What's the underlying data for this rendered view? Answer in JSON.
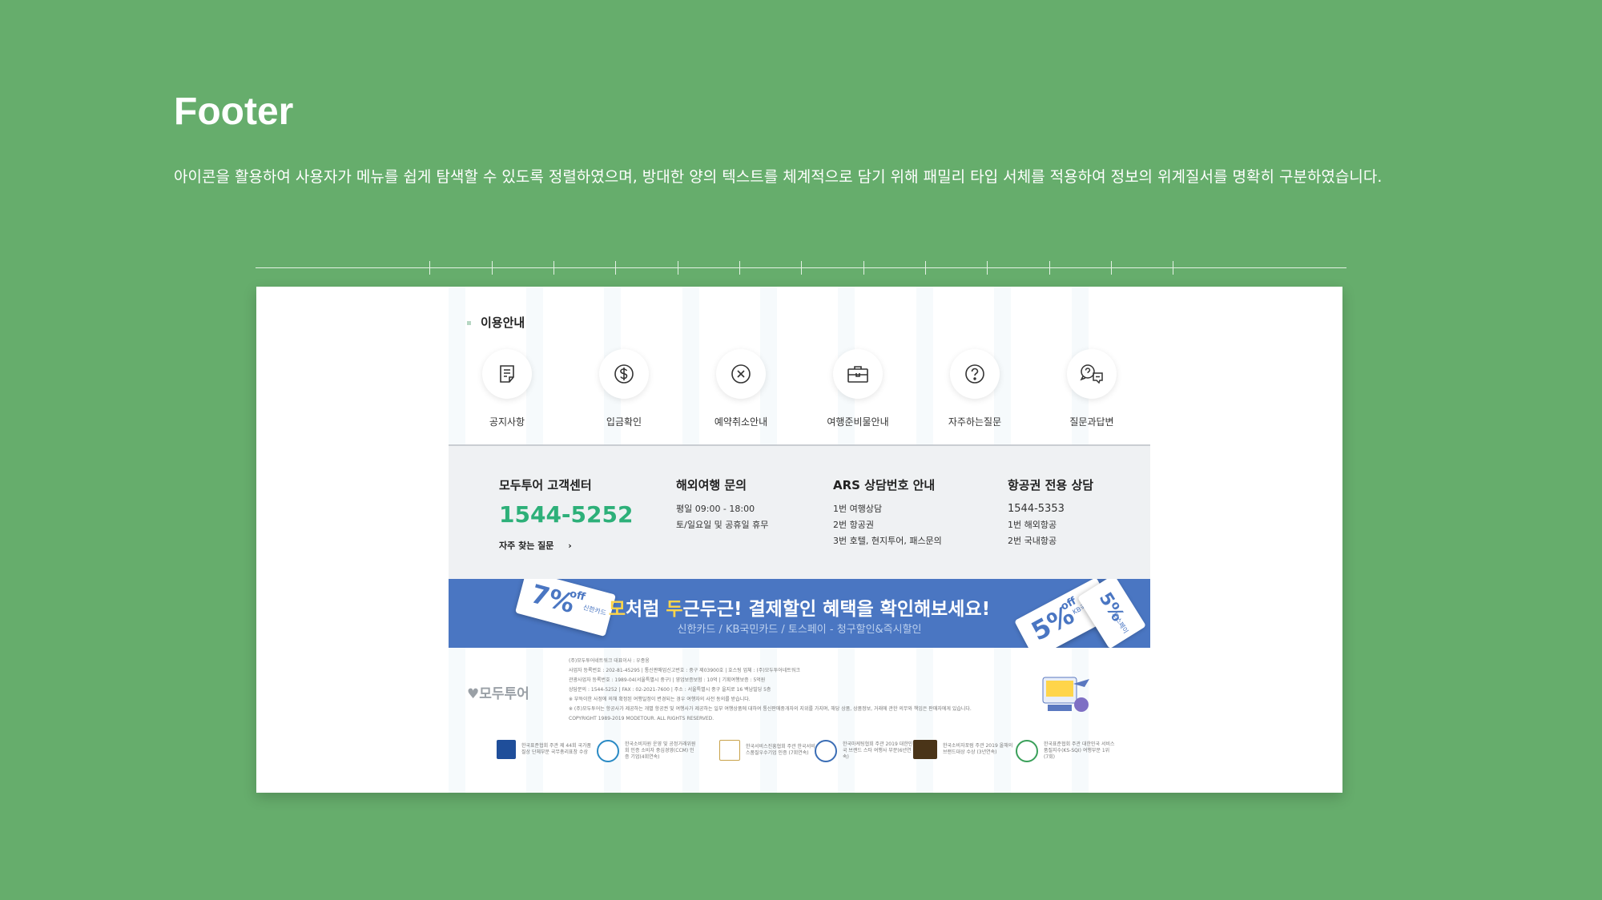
{
  "header": {
    "title": "Footer",
    "description": "아이콘을 활용하여 사용자가 메뉴를 쉽게 탐색할 수 있도록 정렬하였으며, 방대한 양의 텍스트를 체계적으로 담기 위해 패밀리 타입 서체를 적용하여 정보의 위계질서를 명확히 구분하였습니다."
  },
  "guide": {
    "section_title": "이용안내",
    "items": [
      {
        "label": "공지사항",
        "icon": "notice-icon"
      },
      {
        "label": "입금확인",
        "icon": "dollar-icon"
      },
      {
        "label": "예약취소안내",
        "icon": "cancel-icon"
      },
      {
        "label": "여행준비물안내",
        "icon": "briefcase-icon"
      },
      {
        "label": "자주하는질문",
        "icon": "question-icon"
      },
      {
        "label": "질문과답변",
        "icon": "chat-icon"
      }
    ]
  },
  "contact": {
    "center_title": "모두투어 고객센터",
    "center_phone": "1544-5252",
    "faq_link": "자주 찾는 질문",
    "overseas_title": "해외여행 문의",
    "overseas_lines": [
      "평일 09:00 - 18:00",
      "토/일요일 및 공휴일 휴무"
    ],
    "ars_title": "ARS 상담번호 안내",
    "ars_lines": [
      "1번 여행상담",
      "2번 항공권",
      "3번 호텔, 현지투어, 패스문의"
    ],
    "air_title": "항공권 전용 상담",
    "air_lines": [
      "1544-5353",
      "1번 해외항공",
      "2번 국내항공"
    ]
  },
  "banner": {
    "hl1": "모",
    "text1": "처럼 ",
    "hl2": "두",
    "text2": "근두근! 결제할인 혜택을 확인해보세요!",
    "sub": "신한카드 / KB국민카드 / 토스페이 - 청구할인&즉시할인",
    "ticket_left_value": "7%",
    "ticket_left_off": "off",
    "ticket_left_brand": "신한카드",
    "ticket_right_value": "5%",
    "ticket_right_off": "off",
    "ticket_right_brand": "KB국민카드",
    "ticket_far_value": "5%",
    "ticket_far_brand": "토스페이"
  },
  "footer": {
    "logo": "모두투어",
    "company_lines": [
      "(주)모두투어네트워크 대표이사 : 우종웅",
      "사업자 등록번호 : 202-81-45295 | 통신판매업신고번호 : 중구 제03900호 | 호스팅 업체 : (주)모두투어네트워크",
      "관광사업자 등록번호 : 1989-04(서울특별시 중구) | 영업보증보험 : 10억 | 기획여행보증 : 5억원",
      "상담문의 : 1544-5252 | FAX : 02-2021-7600 | 주소 : 서울특별시 중구 을지로 16 백남빌딩 5층",
      "※ 부득이한 사정에 의해 확정된 여행일정이 변경되는 경우 여행자의 사전 동의를 받습니다.",
      "※ (주)모두투어는 항공사가 제공하는 개별 항공권 및 여행사가 제공하는 일부 여행상품에 대하여 통신판매중개자의 지위를 가지며, 해당 상품, 상품정보, 거래에 관한 의무와 책임은 판매자에게 있습니다.",
      "COPYRIGHT 1989-2019 MODETOUR. ALL RIGHTS RESERVED."
    ],
    "certs": [
      {
        "text": "한국표준협회 주관 제 44회 국가품질상 단체부문 국무총리표창 수상",
        "color": "#1f4e9a"
      },
      {
        "text": "한국소비자원 운영 및 공정거래위원회 인증 소비자 중심경영(CCM) 인증 기업(4회연속)",
        "color": "#2a8ac4"
      },
      {
        "text": "한국서비스진흥협회 주관 한국서비스품질우수기업 인증 (7회연속)",
        "color": "#c8a24a"
      },
      {
        "text": "한국마케팅협회 주관 2019 대한민국 브랜드 스타 여행사 부문(6년연속)",
        "color": "#3a6db5"
      },
      {
        "text": "한국소비자포럼 주관 2019 올해의 브랜드대상 수상 (3년연속)",
        "color": "#4a3418"
      },
      {
        "text": "한국표준협회 주관 대한민국 서비스품질지수(KS-SQI) 여행부문 1위 (7회)",
        "color": "#3aa05a"
      }
    ]
  }
}
